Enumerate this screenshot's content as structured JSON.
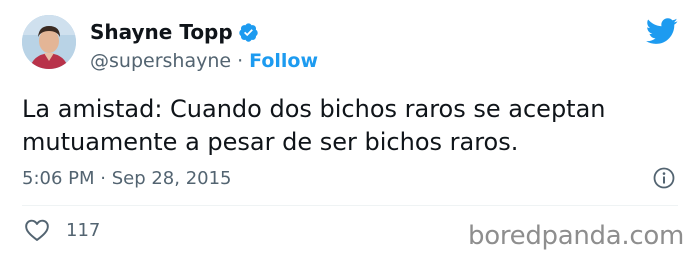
{
  "tweet": {
    "author": {
      "display_name": "Shayne Topp",
      "handle": "@supershayne",
      "verified": true,
      "avatar": "avatar-photo"
    },
    "separator": "·",
    "follow_label": "Follow",
    "text_lines": [
      "La amistad: Cuando dos bichos raros se aceptan",
      "mutuamente a pesar de ser bichos raros."
    ],
    "timestamp": "5:06 PM · Sep 28, 2015",
    "likes": "117"
  },
  "icons": {
    "brand": "twitter-bird-icon",
    "verified": "verified-badge-icon",
    "info": "info-icon",
    "like": "heart-icon"
  },
  "colors": {
    "accent": "#1d9bf0",
    "text": "#0f1419",
    "muted": "#536471"
  },
  "watermark": "boredpanda.com"
}
